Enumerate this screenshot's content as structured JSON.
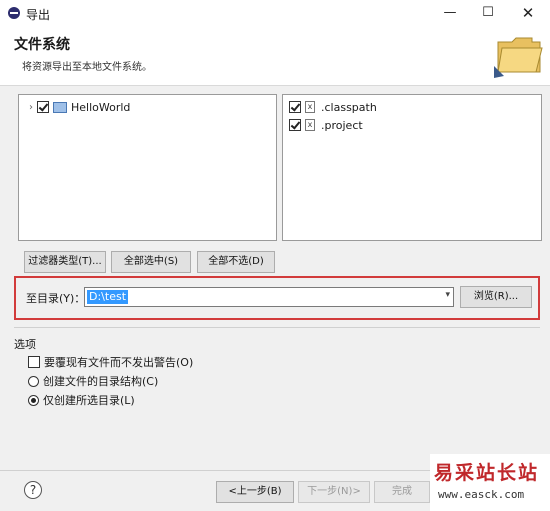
{
  "window": {
    "title": "导出",
    "minimize": "—",
    "maximize": "☐",
    "close": "✕"
  },
  "header": {
    "title": "文件系统",
    "description": "将资源导出至本地文件系统。"
  },
  "left_tree": {
    "items": [
      {
        "label": "HelloWorld",
        "checked": true
      }
    ]
  },
  "right_list": {
    "items": [
      {
        "label": ".classpath",
        "checked": true
      },
      {
        "label": ".project",
        "checked": true
      }
    ]
  },
  "buttons": {
    "filter_types": "过滤器类型(T)...",
    "select_all": "全部选中(S)",
    "deselect_all": "全部不选(D)"
  },
  "destination": {
    "label": "至目录(Y)：",
    "value": "D:\\test",
    "browse": "浏览(R)..."
  },
  "options": {
    "title": "选项",
    "overwrite": "要覆现有文件而不发出警告(O)",
    "create_structure": "创建文件的目录结构(C)",
    "create_selected": "仅创建所选目录(L)",
    "selected_option": "create_selected"
  },
  "footer": {
    "help": "?",
    "back": "<上一步(B)",
    "next": "下一步(N)>",
    "finish": "完成"
  },
  "watermark": {
    "text": "易采站长站",
    "url": "www.easck.com"
  },
  "colors": {
    "highlight_border": "#d23b3b",
    "selection": "#3399ff"
  }
}
